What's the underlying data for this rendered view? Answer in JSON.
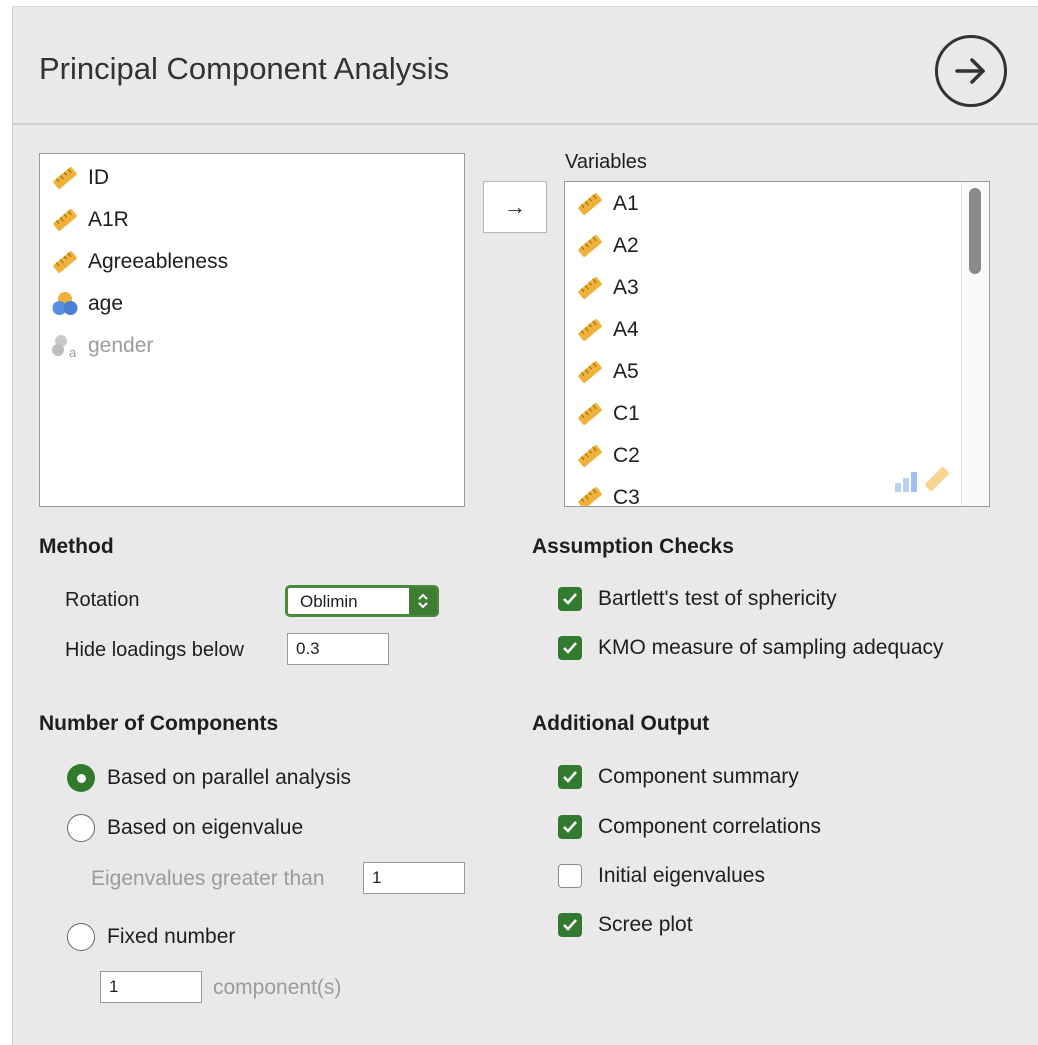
{
  "title": "Principal Component Analysis",
  "colors": {
    "accent": "#327a2f",
    "panel_bg": "#e9e9e9",
    "measure_icon": "#f0b13a",
    "nominal_icon_blue": "#5a8fe0"
  },
  "available_variables": [
    {
      "name": "ID",
      "icon": "ruler-icon",
      "disabled": false
    },
    {
      "name": "A1R",
      "icon": "ruler-icon",
      "disabled": false
    },
    {
      "name": "Agreeableness",
      "icon": "ruler-icon",
      "disabled": false
    },
    {
      "name": "age",
      "icon": "ordinal-circles-icon",
      "disabled": false
    },
    {
      "name": "gender",
      "icon": "nominal-text-icon",
      "disabled": true
    }
  ],
  "transfer_label": "→",
  "variables_box": {
    "label": "Variables",
    "items": [
      "A1",
      "A2",
      "A3",
      "A4",
      "A5",
      "C1",
      "C2",
      "C3"
    ]
  },
  "method": {
    "heading": "Method",
    "rotation_label": "Rotation",
    "rotation_value": "Oblimin",
    "hide_loadings_label": "Hide loadings below",
    "hide_loadings_value": "0.3"
  },
  "assumption_checks": {
    "heading": "Assumption Checks",
    "items": [
      {
        "label": "Bartlett's test of sphericity",
        "checked": true
      },
      {
        "label": "KMO measure of sampling adequacy",
        "checked": true
      }
    ]
  },
  "components": {
    "heading": "Number of Components",
    "parallel_label": "Based on parallel analysis",
    "eigen_label": "Based on eigenvalue",
    "eigen_greater_label": "Eigenvalues greater than",
    "eigen_greater_value": "1",
    "fixed_label": "Fixed number",
    "fixed_value": "1",
    "fixed_suffix": "component(s)",
    "selected": "parallel"
  },
  "additional_output": {
    "heading": "Additional Output",
    "items": [
      {
        "label": "Component summary",
        "checked": true
      },
      {
        "label": "Component correlations",
        "checked": true
      },
      {
        "label": "Initial eigenvalues",
        "checked": false
      },
      {
        "label": "Scree plot",
        "checked": true
      }
    ]
  }
}
